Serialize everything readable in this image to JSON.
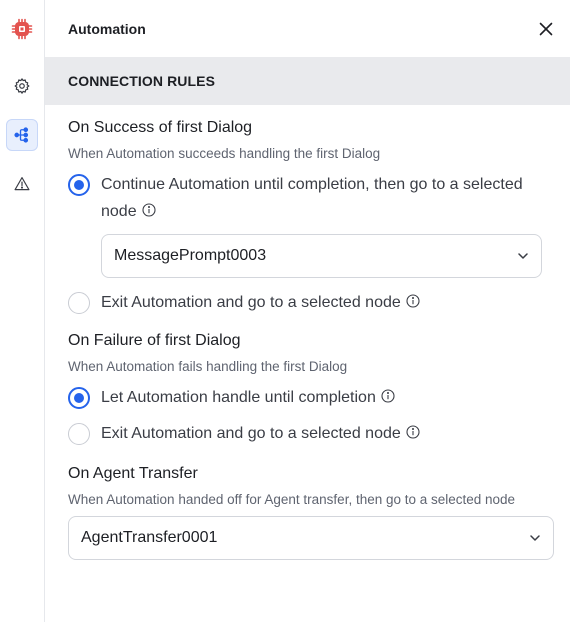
{
  "header": {
    "title": "Automation"
  },
  "section": {
    "title": "CONNECTION RULES"
  },
  "success": {
    "title": "On Success of first Dialog",
    "description": "When Automation succeeds handling the first Dialog",
    "option_continue": {
      "line1": "Continue Automation until completion, then go to a selected",
      "line2": "node",
      "checked": true
    },
    "select_value": "MessagePrompt0003",
    "option_exit": {
      "label": "Exit Automation and go to a selected node",
      "checked": false
    }
  },
  "failure": {
    "title": "On Failure of first Dialog",
    "description": "When Automation fails handling the first Dialog",
    "option_let": {
      "label": "Let Automation handle until completion",
      "checked": true
    },
    "option_exit": {
      "label": "Exit Automation and go to a selected node",
      "checked": false
    }
  },
  "transfer": {
    "title": "On Agent Transfer",
    "description": "When Automation handed off for Agent transfer, then go to a selected node",
    "select_value": "AgentTransfer0001"
  },
  "icons": {
    "logo": "chip-logo-icon",
    "settings": "gear-icon",
    "flow": "flow-nodes-icon",
    "warning": "warning-triangle-icon",
    "close": "close-icon",
    "info": "info-circle-icon",
    "chevron": "chevron-down-icon"
  },
  "colors": {
    "accent": "#2563eb",
    "logo": "#e3534f",
    "section_bg": "#e9eaed"
  }
}
